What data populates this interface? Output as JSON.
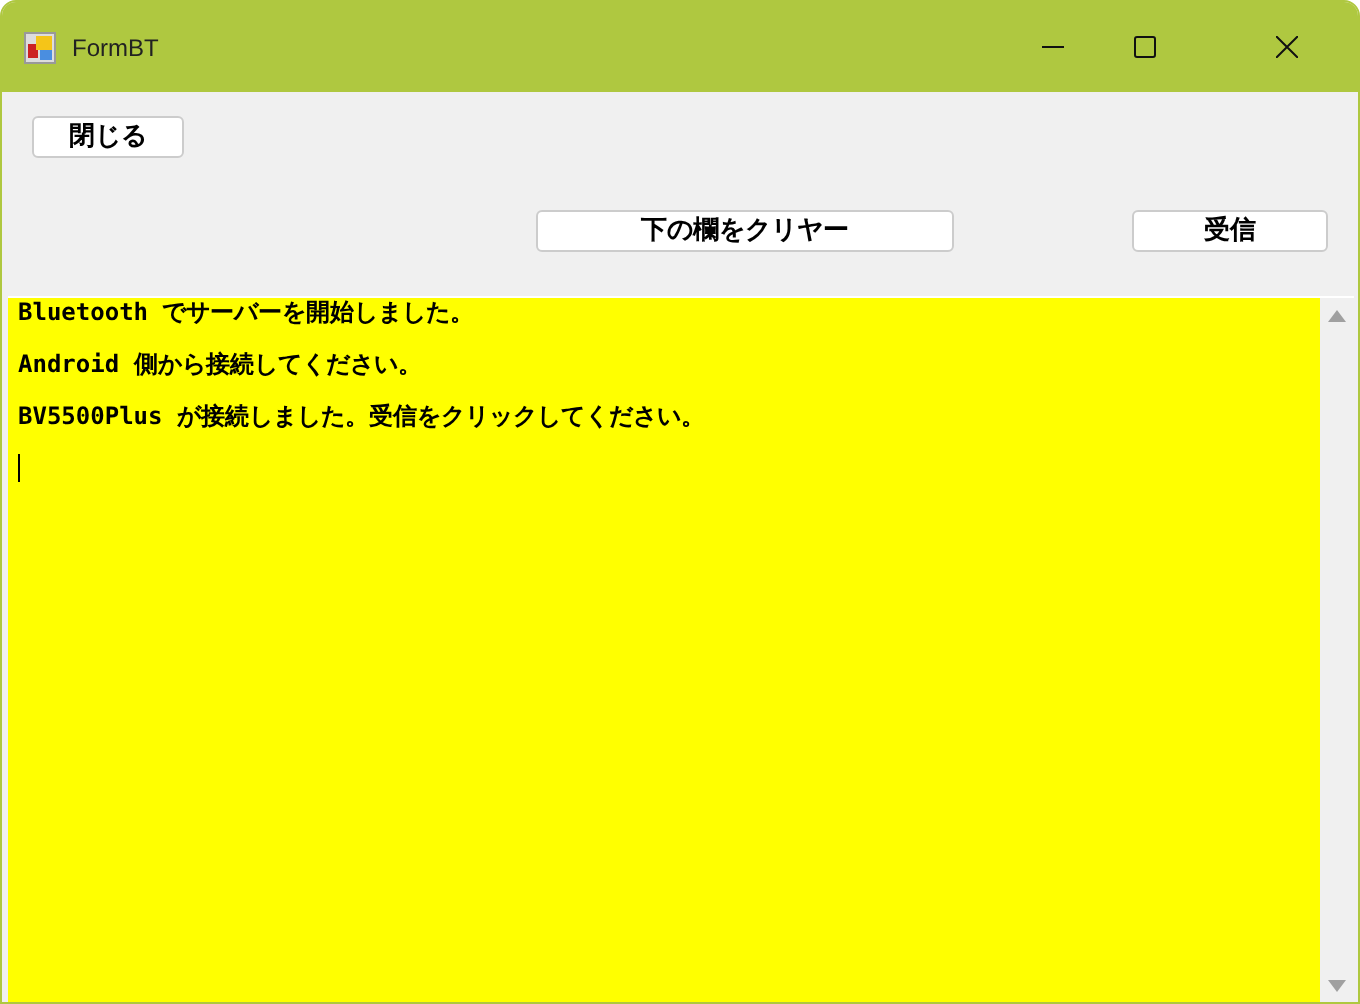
{
  "window": {
    "title": "FormBT"
  },
  "buttons": [
    {
      "label": "閉じる",
      "kind": "top"
    },
    {
      "label": "下の欄をクリヤー",
      "kind": "wide"
    },
    {
      "label": "受信",
      "kind": "side"
    }
  ],
  "log": {
    "lines": [
      "Bluetooth でサーバーを開始しました。",
      "Android 側から接続してください。",
      "BV5500Plus が接続しました。受信をクリックしてください。"
    ],
    "caret": true
  }
}
